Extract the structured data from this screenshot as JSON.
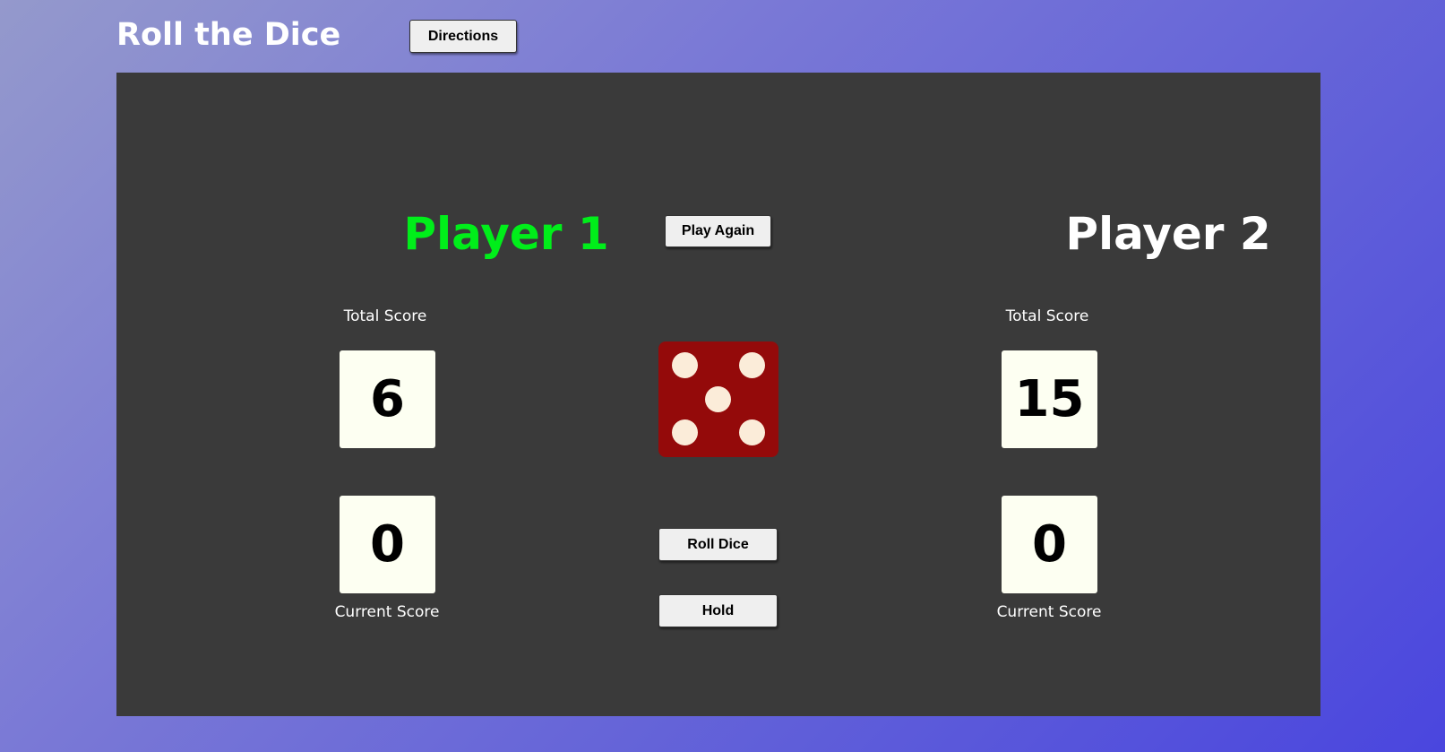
{
  "header": {
    "title": "Roll the Dice",
    "directions_label": "Directions"
  },
  "controls": {
    "play_again_label": "Play Again",
    "roll_label": "Roll Dice",
    "hold_label": "Hold"
  },
  "players": [
    {
      "name": "Player 1",
      "total_label": "Total Score",
      "total_score": "6",
      "current_score": "0",
      "current_label": "Current Score",
      "active": true
    },
    {
      "name": "Player 2",
      "total_label": "Total Score",
      "total_score": "15",
      "current_score": "0",
      "current_label": "Current Score",
      "active": false
    }
  ],
  "dice": {
    "value": 5,
    "icon": "dice-five-icon"
  },
  "colors": {
    "active_player": "#00ee1a",
    "inactive_player": "#ffffff",
    "board": "#3a3a3a",
    "die": "#940a0a",
    "pip": "#fbecd9",
    "score_box": "#fdfff2"
  }
}
